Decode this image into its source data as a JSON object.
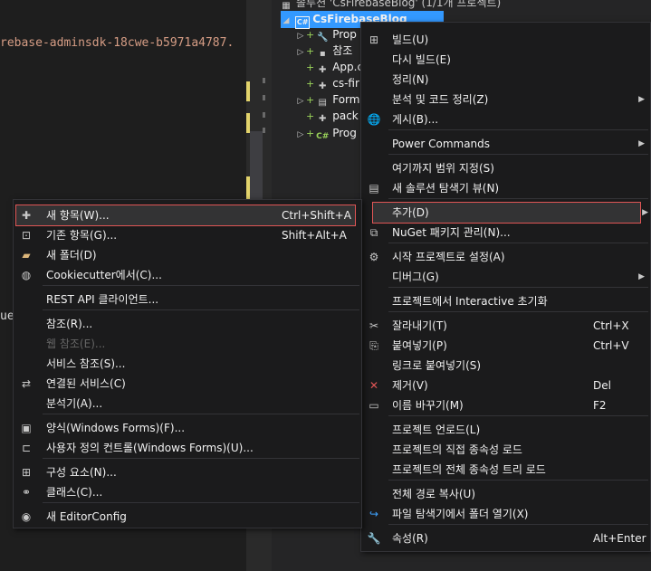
{
  "editor": {
    "code_line": "rebase-adminsdk-18cwe-b5971a4787.",
    "code_line2": "ue"
  },
  "solution_explorer": {
    "solution_label": "솔루션 'CsFirebaseBlog' (1/1개 프로젝트)",
    "project": {
      "icon": "csharp-project-icon",
      "name": "CsFirebaseBlog"
    },
    "items": [
      {
        "label": "Prop",
        "icon": "wrench-icon",
        "expandable": true
      },
      {
        "label": "참조",
        "icon": "references-icon",
        "expandable": true
      },
      {
        "label": "App.c",
        "icon": "config-file-icon",
        "expandable": false
      },
      {
        "label": "cs-fir",
        "icon": "json-file-icon",
        "expandable": false
      },
      {
        "label": "Form",
        "icon": "form-icon",
        "expandable": true
      },
      {
        "label": "pack",
        "icon": "config-file-icon",
        "expandable": false
      },
      {
        "label": "Prog",
        "icon": "csharp-file-icon",
        "expandable": true
      }
    ]
  },
  "context_menu": {
    "items": [
      {
        "label": "빌드(U)",
        "icon": "build-icon"
      },
      {
        "label": "다시 빌드(E)"
      },
      {
        "label": "정리(N)"
      },
      {
        "label": "분석 및 코드 정리(Z)",
        "submenu": true
      },
      {
        "label": "게시(B)...",
        "icon": "globe-icon"
      },
      {
        "label": "Power Commands",
        "submenu": true
      },
      {
        "label": "여기까지 범위 지정(S)"
      },
      {
        "label": "새 솔루션 탐색기 뷰(N)",
        "icon": "new-view-icon"
      },
      {
        "label": "추가(D)",
        "submenu": true,
        "highlighted": true
      },
      {
        "label": "NuGet 패키지 관리(N)...",
        "icon": "nuget-icon"
      },
      {
        "label": "시작 프로젝트로 설정(A)",
        "icon": "gear-icon"
      },
      {
        "label": "디버그(G)",
        "submenu": true
      },
      {
        "label": "프로젝트에서 Interactive 초기화"
      },
      {
        "label": "잘라내기(T)",
        "icon": "scissors-icon",
        "shortcut": "Ctrl+X"
      },
      {
        "label": "붙여넣기(P)",
        "icon": "paste-icon",
        "shortcut": "Ctrl+V"
      },
      {
        "label": "링크로 붙여넣기(S)"
      },
      {
        "label": "제거(V)",
        "icon": "delete-icon",
        "shortcut": "Del"
      },
      {
        "label": "이름 바꾸기(M)",
        "icon": "rename-icon",
        "shortcut": "F2"
      },
      {
        "label": "프로젝트 언로드(L)"
      },
      {
        "label": "프로젝트의 직접 종속성 로드"
      },
      {
        "label": "프로젝트의 전체 종속성 트리 로드"
      },
      {
        "label": "전체 경로 복사(U)"
      },
      {
        "label": "파일 탐색기에서 폴더 열기(X)",
        "icon": "refresh-arrow-icon"
      },
      {
        "label": "속성(R)",
        "icon": "wrench-icon",
        "shortcut": "Alt+Enter"
      }
    ]
  },
  "add_submenu": {
    "items": [
      {
        "label": "새 항목(W)...",
        "icon": "new-item-icon",
        "shortcut": "Ctrl+Shift+A",
        "highlighted": true
      },
      {
        "label": "기존 항목(G)...",
        "icon": "existing-item-icon",
        "shortcut": "Shift+Alt+A"
      },
      {
        "label": "새 폴더(D)",
        "icon": "new-folder-icon"
      },
      {
        "label": "Cookiecutter에서(C)...",
        "icon": "cookiecutter-icon"
      },
      {
        "label": "REST API 클라이언트..."
      },
      {
        "label": "참조(R)..."
      },
      {
        "label": "웹 참조(E)...",
        "disabled": true
      },
      {
        "label": "서비스 참조(S)..."
      },
      {
        "label": "연결된 서비스(C)",
        "icon": "connected-service-icon"
      },
      {
        "label": "분석기(A)..."
      },
      {
        "label": "양식(Windows Forms)(F)...",
        "icon": "form-add-icon"
      },
      {
        "label": "사용자 정의 컨트롤(Windows Forms)(U)...",
        "icon": "user-control-icon"
      },
      {
        "label": "구성 요소(N)...",
        "icon": "component-icon"
      },
      {
        "label": "클래스(C)...",
        "icon": "class-icon"
      },
      {
        "label": "새 EditorConfig",
        "icon": "editorconfig-icon"
      }
    ]
  },
  "colors": {
    "selection": "#3399ff",
    "highlight_border": "#e05555",
    "menu_bg": "#1b1b1c"
  }
}
